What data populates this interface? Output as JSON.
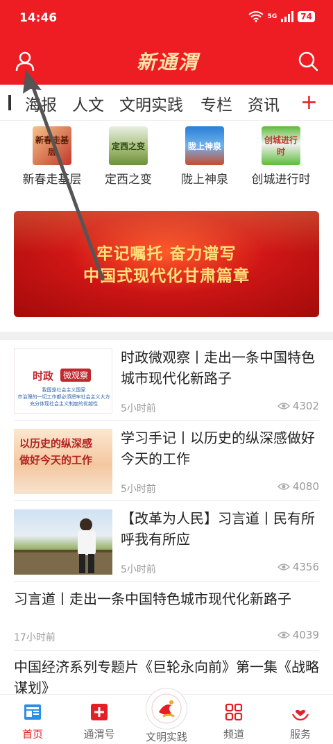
{
  "status": {
    "time": "14:46",
    "network": "5G",
    "battery": "74"
  },
  "header": {
    "logo_text": "新通渭"
  },
  "tabs": [
    {
      "label": "海报"
    },
    {
      "label": "人文"
    },
    {
      "label": "文明实践"
    },
    {
      "label": "专栏"
    },
    {
      "label": "资讯"
    }
  ],
  "tabs_add": "+",
  "quick": [
    {
      "label": "新春走基层",
      "thumb_text": "新春走基层"
    },
    {
      "label": "定西之变",
      "thumb_text": "定西之变"
    },
    {
      "label": "陇上神泉",
      "thumb_text": "陇上神泉"
    },
    {
      "label": "创城进行时",
      "thumb_text": "创城进行时"
    }
  ],
  "banner": {
    "line1": "牢记嘱托 奋力谱写",
    "line2": "中国式现代化甘肃篇章"
  },
  "news": [
    {
      "title": "时政微观察丨走出一条中国特色城市现代化新路子",
      "time": "5小时前",
      "views": "4302",
      "img_title_a": "时政",
      "img_title_b": "微观察",
      "img_lines": [
        "我国是社会主义国家",
        "市治理的一切工作都必须把牢社会主义大方",
        "充分体现社会主义制度的优越性"
      ]
    },
    {
      "title": "学习手记丨以历史的纵深感做好今天的工作",
      "time": "5小时前",
      "views": "4080",
      "img_line1": "以历史的纵深感",
      "img_line2": "做好今天的工作"
    },
    {
      "title": "【改革为人民】习言道丨民有所呼我有所应",
      "time": "5小时前",
      "views": "4356"
    },
    {
      "title": "习言道丨走出一条中国特色城市现代化新路子",
      "time": "17小时前",
      "views": "4039"
    },
    {
      "title": "中国经济系列专题片《巨轮永向前》第一集《战略谋划》"
    }
  ],
  "tabbar": [
    {
      "label": "首页"
    },
    {
      "label": "通渭号"
    },
    {
      "label": "文明实践"
    },
    {
      "label": "频道"
    },
    {
      "label": "服务"
    }
  ],
  "colors": {
    "brand": "#ee1d23",
    "accent": "#e61e25",
    "muted": "#999999"
  }
}
